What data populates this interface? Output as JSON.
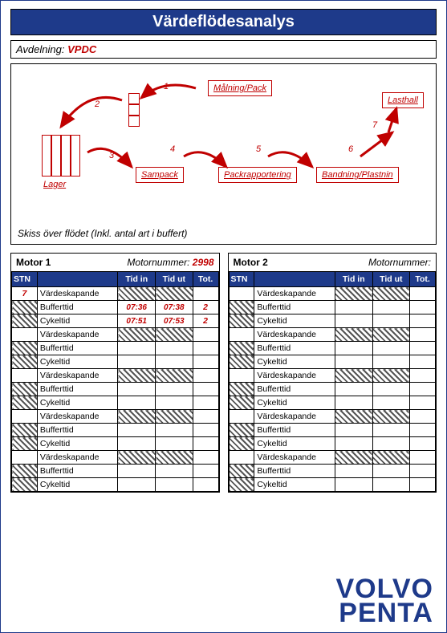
{
  "title": "Värdeflödesanalys",
  "avdelning_label": "Avdelning:",
  "avdelning_value": "VPDC",
  "sketch_caption": "Skiss över flödet (Inkl. antal art i buffert)",
  "flow": {
    "lager": "Lager",
    "malning": "Målning/Pack",
    "sampack": "Sampack",
    "packrapp": "Packrapportering",
    "bandning": "Bandning/Plastnin",
    "lasthall": "Lasthall",
    "n1": "1",
    "n2": "2",
    "n3": "3",
    "n4": "4",
    "n5": "5",
    "n6": "6",
    "n7": "7"
  },
  "motor1": {
    "title": "Motor 1",
    "mn_label": "Motornummer:",
    "mn_value": "2998",
    "cols": {
      "stn": "STN",
      "blank": "",
      "tin": "Tid in",
      "tut": "Tid ut",
      "tot": "Tot."
    },
    "rows": [
      {
        "stn": "7",
        "label": "Värdeskapande",
        "hatch_t": true,
        "tin": "",
        "tut": "",
        "tot": ""
      },
      {
        "hatch_stn": true,
        "label": "Bufferttid",
        "tin": "07:36",
        "tut": "07:38",
        "tot": "2"
      },
      {
        "hatch_stn": true,
        "label": "Cykeltid",
        "tin": "07:51",
        "tut": "07:53",
        "tot": "2"
      },
      {
        "stn": "",
        "label": "Värdeskapande",
        "hatch_t": true,
        "tin": "",
        "tut": "",
        "tot": ""
      },
      {
        "hatch_stn": true,
        "label": "Bufferttid",
        "tin": "",
        "tut": "",
        "tot": ""
      },
      {
        "hatch_stn": true,
        "label": "Cykeltid",
        "tin": "",
        "tut": "",
        "tot": ""
      },
      {
        "stn": "",
        "label": "Värdeskapande",
        "hatch_t": true,
        "tin": "",
        "tut": "",
        "tot": ""
      },
      {
        "hatch_stn": true,
        "label": "Bufferttid",
        "tin": "",
        "tut": "",
        "tot": ""
      },
      {
        "hatch_stn": true,
        "label": "Cykeltid",
        "tin": "",
        "tut": "",
        "tot": ""
      },
      {
        "stn": "",
        "label": "Värdeskapande",
        "hatch_t": true,
        "tin": "",
        "tut": "",
        "tot": ""
      },
      {
        "hatch_stn": true,
        "label": "Bufferttid",
        "tin": "",
        "tut": "",
        "tot": ""
      },
      {
        "hatch_stn": true,
        "label": "Cykeltid",
        "tin": "",
        "tut": "",
        "tot": ""
      },
      {
        "stn": "",
        "label": "Värdeskapande",
        "hatch_t": true,
        "tin": "",
        "tut": "",
        "tot": ""
      },
      {
        "hatch_stn": true,
        "label": "Bufferttid",
        "tin": "",
        "tut": "",
        "tot": ""
      },
      {
        "hatch_stn": true,
        "label": "Cykeltid",
        "tin": "",
        "tut": "",
        "tot": ""
      }
    ]
  },
  "motor2": {
    "title": "Motor 2",
    "mn_label": "Motornummer:",
    "mn_value": "",
    "cols": {
      "stn": "STN",
      "blank": "",
      "tin": "Tid in",
      "tut": "Tid ut",
      "tot": "Tot."
    },
    "rows": [
      {
        "stn": "",
        "label": "Värdeskapande",
        "hatch_t": true,
        "tin": "",
        "tut": "",
        "tot": ""
      },
      {
        "hatch_stn": true,
        "label": "Bufferttid",
        "tin": "",
        "tut": "",
        "tot": ""
      },
      {
        "hatch_stn": true,
        "label": "Cykeltid",
        "tin": "",
        "tut": "",
        "tot": ""
      },
      {
        "stn": "",
        "label": "Värdeskapande",
        "hatch_t": true,
        "tin": "",
        "tut": "",
        "tot": ""
      },
      {
        "hatch_stn": true,
        "label": "Bufferttid",
        "tin": "",
        "tut": "",
        "tot": ""
      },
      {
        "hatch_stn": true,
        "label": "Cykeltid",
        "tin": "",
        "tut": "",
        "tot": ""
      },
      {
        "stn": "",
        "label": "Värdeskapande",
        "hatch_t": true,
        "tin": "",
        "tut": "",
        "tot": ""
      },
      {
        "hatch_stn": true,
        "label": "Bufferttid",
        "tin": "",
        "tut": "",
        "tot": ""
      },
      {
        "hatch_stn": true,
        "label": "Cykeltid",
        "tin": "",
        "tut": "",
        "tot": ""
      },
      {
        "stn": "",
        "label": "Värdeskapande",
        "hatch_t": true,
        "tin": "",
        "tut": "",
        "tot": ""
      },
      {
        "hatch_stn": true,
        "label": "Bufferttid",
        "tin": "",
        "tut": "",
        "tot": ""
      },
      {
        "hatch_stn": true,
        "label": "Cykeltid",
        "tin": "",
        "tut": "",
        "tot": ""
      },
      {
        "stn": "",
        "label": "Värdeskapande",
        "hatch_t": true,
        "tin": "",
        "tut": "",
        "tot": ""
      },
      {
        "hatch_stn": true,
        "label": "Bufferttid",
        "tin": "",
        "tut": "",
        "tot": ""
      },
      {
        "hatch_stn": true,
        "label": "Cykeltid",
        "tin": "",
        "tut": "",
        "tot": ""
      }
    ]
  },
  "logo": {
    "l1": "VOLVO",
    "l2": "PENTA"
  }
}
